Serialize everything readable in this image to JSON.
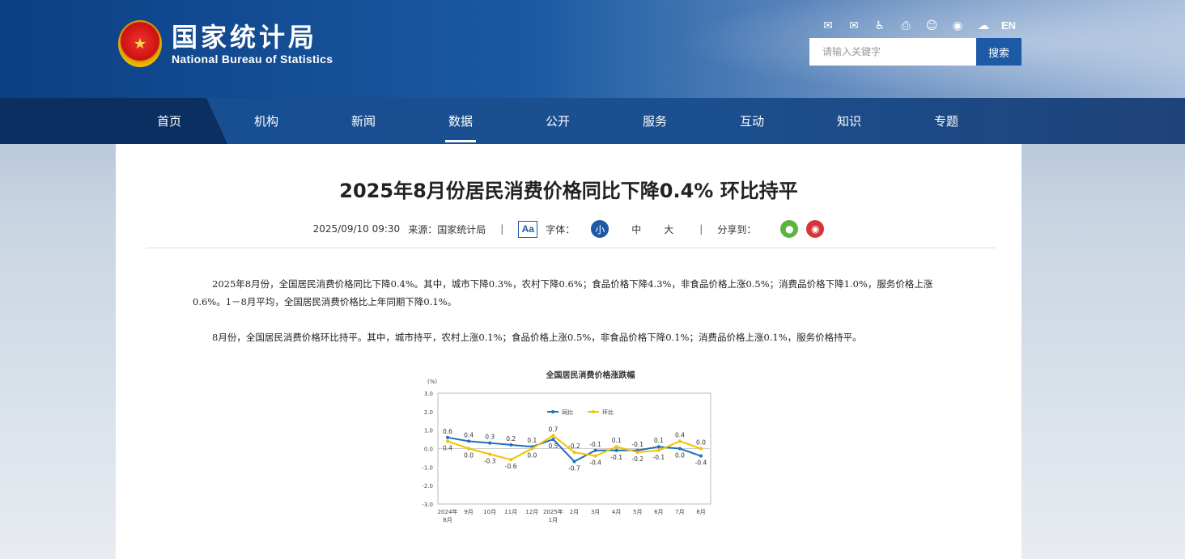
{
  "header": {
    "logo_cn": "国家统计局",
    "logo_en": "National Bureau of Statistics",
    "icons": [
      "mail-icon",
      "mailbox-icon",
      "accessibility-icon",
      "print-icon",
      "robot-icon",
      "weibo-icon",
      "wechat-icon"
    ],
    "lang": "EN",
    "search_placeholder": "请输入关键字",
    "search_button": "搜索"
  },
  "nav": {
    "items": [
      {
        "label": "首页"
      },
      {
        "label": "机构"
      },
      {
        "label": "新闻"
      },
      {
        "label": "数据"
      },
      {
        "label": "公开"
      },
      {
        "label": "服务"
      },
      {
        "label": "互动"
      },
      {
        "label": "知识"
      },
      {
        "label": "专题"
      }
    ],
    "active_index": 3
  },
  "article": {
    "title": "2025年8月份居民消费价格同比下降0.4% 环比持平",
    "date": "2025/09/10 09:30",
    "source": "来源：国家统计局",
    "font_toggle": "Aa",
    "font_label": "字体：",
    "size_small": "小",
    "size_medium": "中",
    "size_large": "大",
    "share_label": "分享到：",
    "para1": "2025年8月份，全国居民消费价格同比下降0.4%。其中，城市下降0.3%，农村下降0.6%；食品价格下降4.3%，非食品价格上涨0.5%；消费品价格下降1.0%，服务价格上涨0.6%。1－8月平均，全国居民消费价格比上年同期下降0.1%。",
    "para2": "8月份，全国居民消费价格环比持平。其中，城市持平，农村上涨0.1%；食品价格上涨0.5%，非食品价格下降0.1%；消费品价格上涨0.1%，服务价格持平。"
  },
  "colors": {
    "brand_blue": "#1d5aa6",
    "yoy_line": "#1f6fbf",
    "mom_line": "#f2c200"
  },
  "chart_data": {
    "type": "line",
    "title": "全国居民消费价格涨跌幅",
    "ylabel": "(%)",
    "ylim": [
      -3.0,
      3.0
    ],
    "yticks": [
      "3.0",
      "2.0",
      "1.0",
      "0.0",
      "-1.0",
      "-2.0",
      "-3.0"
    ],
    "categories": [
      "2024年8月",
      "9月",
      "10月",
      "11月",
      "12月",
      "2025年1月",
      "2月",
      "3月",
      "4月",
      "5月",
      "6月",
      "7月",
      "8月"
    ],
    "category_lines": [
      [
        "2024年",
        "8月"
      ],
      [
        "9月"
      ],
      [
        "10月"
      ],
      [
        "11月"
      ],
      [
        "12月"
      ],
      [
        "2025年",
        "1月"
      ],
      [
        "2月"
      ],
      [
        "3月"
      ],
      [
        "4月"
      ],
      [
        "5月"
      ],
      [
        "6月"
      ],
      [
        "7月"
      ],
      [
        "8月"
      ]
    ],
    "legend_position": "top-center",
    "series": [
      {
        "name": "同比",
        "values": [
          0.6,
          0.4,
          0.3,
          0.2,
          0.1,
          0.5,
          -0.7,
          -0.1,
          -0.1,
          -0.1,
          0.1,
          0.0,
          -0.4
        ]
      },
      {
        "name": "环比",
        "values": [
          0.4,
          0.0,
          -0.3,
          -0.6,
          0.0,
          0.7,
          -0.2,
          -0.4,
          0.1,
          -0.2,
          -0.1,
          0.4,
          0.0
        ]
      }
    ]
  }
}
